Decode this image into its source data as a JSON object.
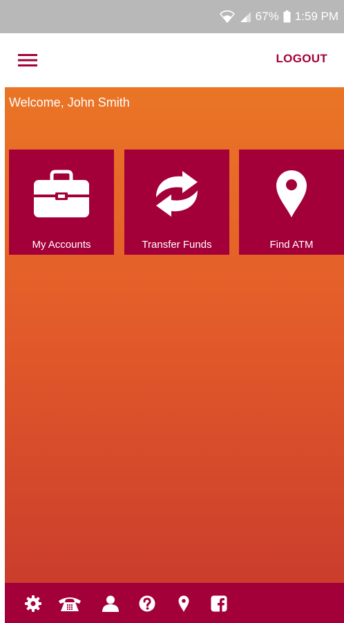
{
  "status_bar": {
    "battery": "67%",
    "time": "1:59 PM",
    "icons": [
      "wifi-icon",
      "signal-icon",
      "battery-icon"
    ]
  },
  "app_bar": {
    "menu_icon": "hamburger-menu-icon",
    "logout_label": "LOGOUT"
  },
  "main": {
    "welcome_text": "Welcome, John Smith",
    "tiles": [
      {
        "label": "My Accounts",
        "icon": "briefcase-icon"
      },
      {
        "label": "Transfer Funds",
        "icon": "transfer-arrows-icon"
      },
      {
        "label": "Find ATM",
        "icon": "map-pin-icon"
      }
    ]
  },
  "bottom_bar": {
    "icons": [
      "gear-icon",
      "telephone-icon",
      "user-icon",
      "question-icon",
      "map-pin-icon",
      "facebook-icon"
    ]
  },
  "colors": {
    "status_bar_bg": "#b8b8b8",
    "brand_crimson": "#a3003a",
    "gradient_top": "#ea7526",
    "gradient_bottom": "#cb3d2c",
    "text_light": "#ffffff"
  }
}
